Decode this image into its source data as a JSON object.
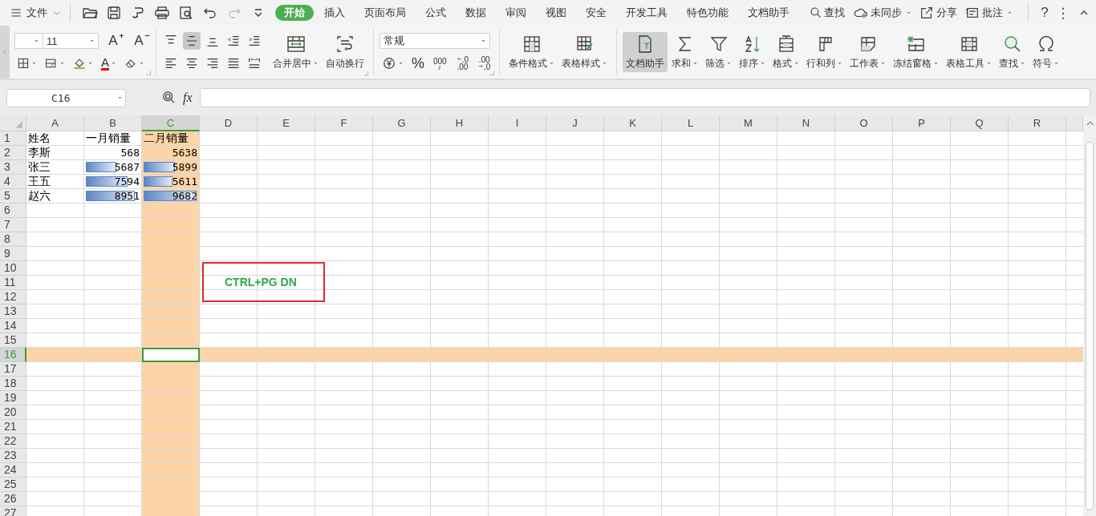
{
  "menu_button": {
    "label": "文件"
  },
  "quick_access": [
    {
      "disabled": false
    },
    {
      "disabled": false
    },
    {
      "disabled": false
    },
    {
      "disabled": false
    },
    {
      "disabled": false
    },
    {
      "disabled": false
    },
    {
      "disabled": true
    },
    {
      "disabled": false
    }
  ],
  "tabs": [
    {
      "label": "开始",
      "selected": true
    },
    {
      "label": "插入",
      "selected": false
    },
    {
      "label": "页面布局",
      "selected": false
    },
    {
      "label": "公式",
      "selected": false
    },
    {
      "label": "数据",
      "selected": false
    },
    {
      "label": "审阅",
      "selected": false
    },
    {
      "label": "视图",
      "selected": false
    },
    {
      "label": "安全",
      "selected": false
    },
    {
      "label": "开发工具",
      "selected": false
    },
    {
      "label": "特色功能",
      "selected": false
    },
    {
      "label": "文档助手",
      "selected": false
    }
  ],
  "search_tab": {
    "label": "查找"
  },
  "status_actions": [
    {
      "label": "未同步",
      "dropdown": true
    },
    {
      "label": "分享",
      "dropdown": false
    },
    {
      "label": "批注",
      "dropdown": true
    }
  ],
  "help": "?",
  "more": "⋮",
  "ribbon": {
    "font_size": "11",
    "font_grow": "A",
    "font_shrink": "A",
    "font_color": "A",
    "vertical_align": [
      {
        "selected": false
      },
      {
        "selected": true
      },
      {
        "selected": false
      }
    ],
    "merge_buttons": [
      {
        "label": "合并居中",
        "dropdown": true
      },
      {
        "label": "自动换行",
        "dropdown": false
      }
    ],
    "number_format": "常规",
    "percent": "%",
    "thousands": "000",
    "decimals": [
      {
        "top": ".0",
        "bottom": ".00"
      },
      {
        "top": ".00",
        "bottom": ".0"
      }
    ],
    "style_tools": [
      {
        "label": "条件格式",
        "dropdown": true,
        "pressed": false
      },
      {
        "label": "表格样式",
        "dropdown": true,
        "pressed": false
      }
    ],
    "tools": [
      {
        "label": "文档助手",
        "dropdown": false,
        "pressed": true
      },
      {
        "label": "求和",
        "dropdown": true,
        "pressed": false
      },
      {
        "label": "筛选",
        "dropdown": true,
        "pressed": false
      },
      {
        "label": "排序",
        "dropdown": true,
        "pressed": false
      },
      {
        "label": "格式",
        "dropdown": true,
        "pressed": false
      },
      {
        "label": "行和列",
        "dropdown": true,
        "pressed": false
      },
      {
        "label": "工作表",
        "dropdown": true,
        "pressed": false
      },
      {
        "label": "冻结窗格",
        "dropdown": true,
        "pressed": false
      },
      {
        "label": "表格工具",
        "dropdown": true,
        "pressed": false
      },
      {
        "label": "查找",
        "dropdown": true,
        "pressed": false
      },
      {
        "label": "符号",
        "dropdown": true,
        "pressed": false
      }
    ]
  },
  "name_box": "C16",
  "formula_label": "fx",
  "columns": [
    {
      "label": "A",
      "selected": false
    },
    {
      "label": "B",
      "selected": false
    },
    {
      "label": "C",
      "selected": true
    },
    {
      "label": "D",
      "selected": false
    },
    {
      "label": "E",
      "selected": false
    },
    {
      "label": "F",
      "selected": false
    },
    {
      "label": "G",
      "selected": false
    },
    {
      "label": "H",
      "selected": false
    },
    {
      "label": "I",
      "selected": false
    },
    {
      "label": "J",
      "selected": false
    },
    {
      "label": "K",
      "selected": false
    },
    {
      "label": "L",
      "selected": false
    },
    {
      "label": "M",
      "selected": false
    },
    {
      "label": "N",
      "selected": false
    },
    {
      "label": "O",
      "selected": false
    },
    {
      "label": "P",
      "selected": false
    },
    {
      "label": "Q",
      "selected": false
    },
    {
      "label": "R",
      "selected": false
    }
  ],
  "rows": [
    {
      "label": "1",
      "selected": false,
      "cells": [
        {
          "text": "姓名",
          "kind": "text"
        },
        {
          "text": "一月销量",
          "kind": "text"
        },
        {
          "text": "二月销量",
          "kind": "text"
        }
      ]
    },
    {
      "label": "2",
      "selected": false,
      "cells": [
        {
          "text": "李斯",
          "kind": "text"
        },
        {
          "text": "568",
          "kind": "number"
        },
        {
          "text": "5638",
          "kind": "number"
        }
      ]
    },
    {
      "label": "3",
      "selected": false,
      "cells": [
        {
          "text": "张三",
          "kind": "text"
        },
        {
          "text": "5687",
          "kind": "number",
          "level": 0.6
        },
        {
          "text": "5899",
          "kind": "number",
          "level": 0.62
        }
      ]
    },
    {
      "label": "4",
      "selected": false,
      "cells": [
        {
          "text": "王五",
          "kind": "text"
        },
        {
          "text": "7594",
          "kind": "number",
          "level": 0.8
        },
        {
          "text": "5611",
          "kind": "number",
          "level": 0.58
        }
      ]
    },
    {
      "label": "5",
      "selected": false,
      "cells": [
        {
          "text": "赵六",
          "kind": "text"
        },
        {
          "text": "8951",
          "kind": "number",
          "level": 0.93
        },
        {
          "text": "9682",
          "kind": "number",
          "level": 1.0
        }
      ]
    },
    {
      "label": "6",
      "selected": false
    },
    {
      "label": "7",
      "selected": false
    },
    {
      "label": "8",
      "selected": false
    },
    {
      "label": "9",
      "selected": false
    },
    {
      "label": "10",
      "selected": false
    },
    {
      "label": "11",
      "selected": false
    },
    {
      "label": "12",
      "selected": false
    },
    {
      "label": "13",
      "selected": false
    },
    {
      "label": "14",
      "selected": false
    },
    {
      "label": "15",
      "selected": false
    },
    {
      "label": "16",
      "selected": true
    },
    {
      "label": "17",
      "selected": false
    },
    {
      "label": "18",
      "selected": false
    },
    {
      "label": "19",
      "selected": false
    },
    {
      "label": "20",
      "selected": false
    },
    {
      "label": "21",
      "selected": false
    },
    {
      "label": "22",
      "selected": false
    },
    {
      "label": "23",
      "selected": false
    },
    {
      "label": "24",
      "selected": false
    },
    {
      "label": "25",
      "selected": false
    },
    {
      "label": "26",
      "selected": false
    },
    {
      "label": "27",
      "selected": false
    }
  ],
  "note": {
    "text": "CTRL+PG DN"
  }
}
